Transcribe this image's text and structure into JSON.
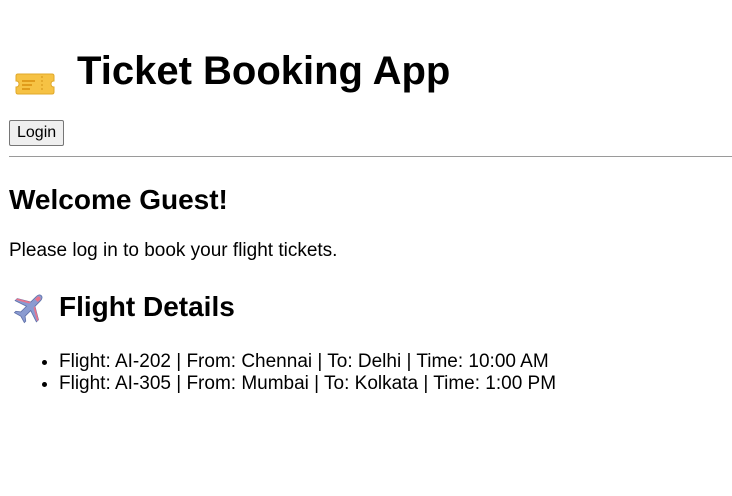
{
  "app": {
    "title": "Ticket Booking App",
    "title_icon": "ticket-icon",
    "login_label": "Login"
  },
  "welcome": {
    "heading": "Welcome Guest!",
    "prompt": "Please log in to book your flight tickets."
  },
  "flights": {
    "heading": "Flight Details",
    "heading_icon": "airplane-icon",
    "items": [
      "Flight: AI-202 | From: Chennai | To: Delhi | Time: 10:00 AM",
      "Flight: AI-305 | From: Mumbai | To: Kolkata | Time: 1:00 PM"
    ]
  },
  "colors": {
    "ticket_icon": "#f6c244",
    "plane_icon": "#8a9bd1",
    "divider": "#9a9a9a"
  }
}
